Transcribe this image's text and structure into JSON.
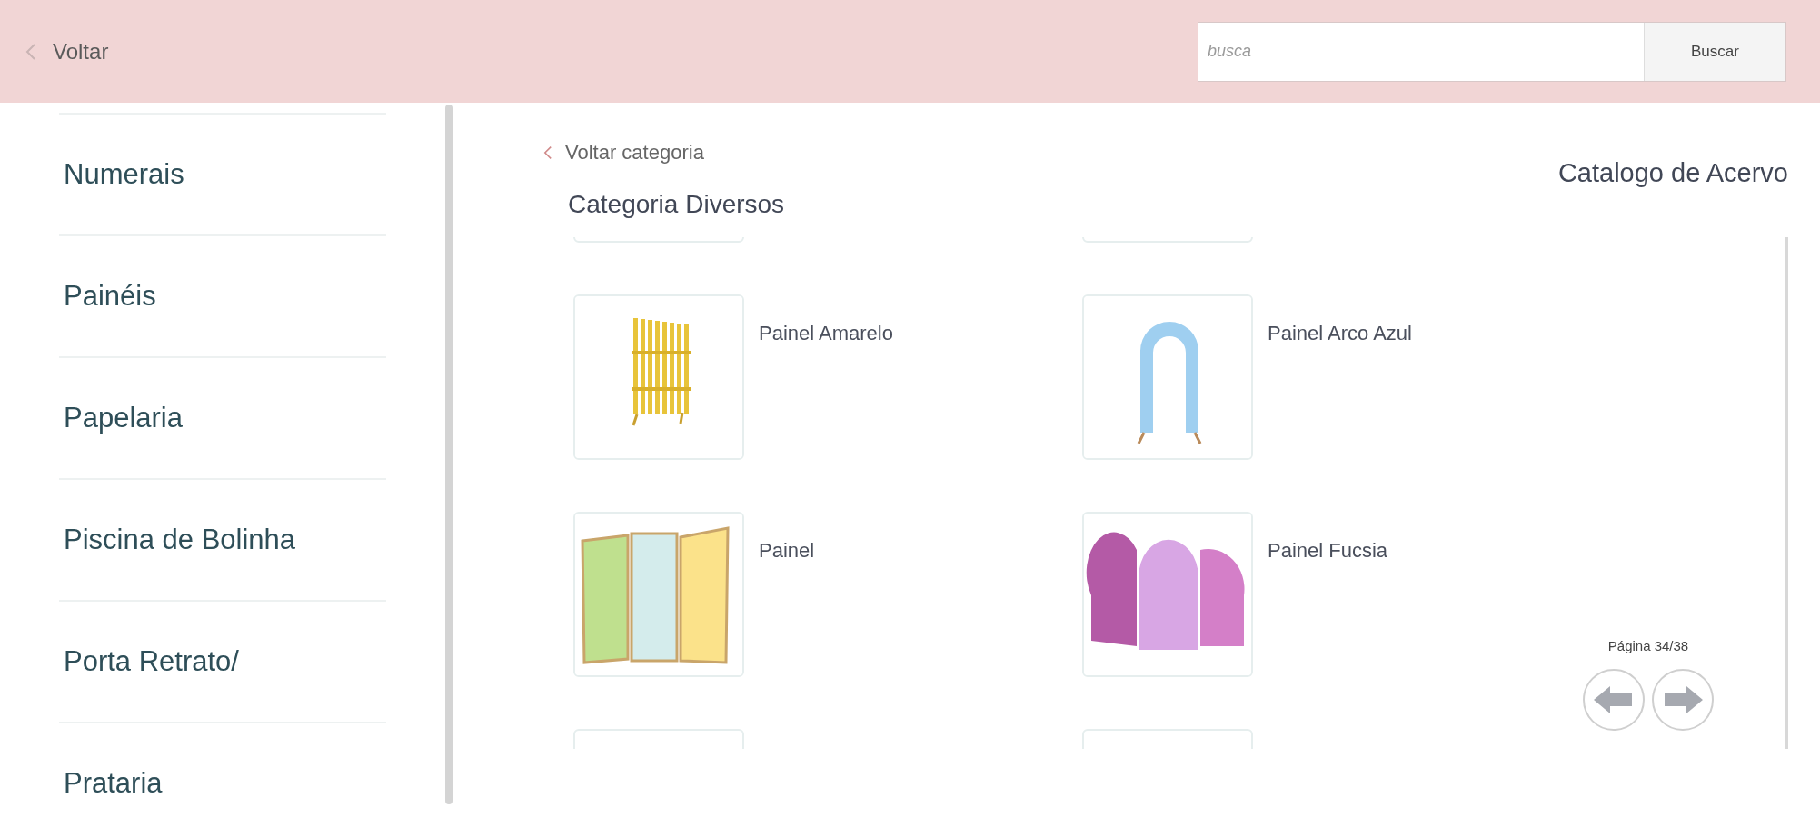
{
  "header": {
    "back_label": "Voltar",
    "search": {
      "placeholder": "busca"
    },
    "search_button": "Buscar"
  },
  "sidebar": {
    "items": [
      {
        "label": "Numerais"
      },
      {
        "label": "Painéis"
      },
      {
        "label": "Papelaria"
      },
      {
        "label": "Piscina de Bolinha"
      },
      {
        "label": "Porta Retrato/"
      },
      {
        "label": "Prataria"
      }
    ]
  },
  "main": {
    "back_link": "Voltar categoria",
    "catalog_title": "Catalogo de Acervo",
    "category_title": "Categoria Diversos",
    "products": [
      {
        "name": "Painel Amarelo"
      },
      {
        "name": "Painel Arco Azul"
      },
      {
        "name": "Painel"
      },
      {
        "name": "Painel Fucsia"
      }
    ],
    "pagination": {
      "label": "Página 34/38"
    }
  }
}
